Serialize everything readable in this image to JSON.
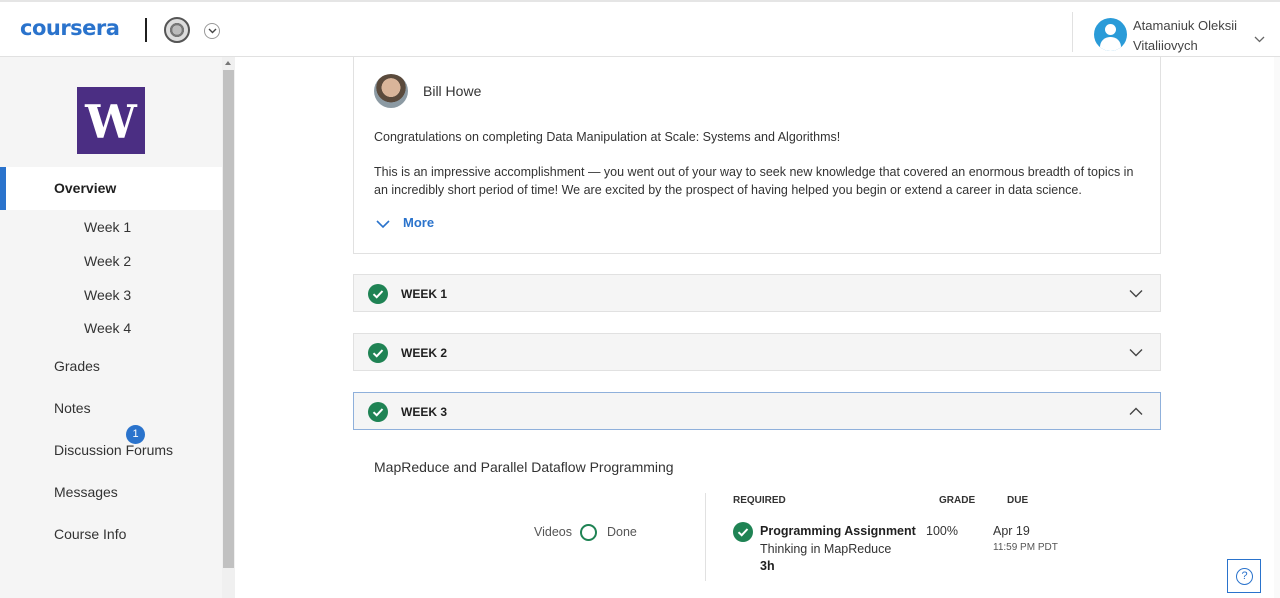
{
  "header": {
    "logo": "coursera",
    "user_name_line1": "Atamaniuk Oleksii",
    "user_name_line2": "Vitaliiovych"
  },
  "sidebar": {
    "logo_letter": "W",
    "active": "Overview",
    "weeks": [
      "Week 1",
      "Week 2",
      "Week 3",
      "Week 4"
    ],
    "items": [
      "Grades",
      "Notes",
      "Discussion Forums",
      "Messages",
      "Course Info"
    ],
    "messages_badge": "1"
  },
  "instructor": {
    "name": "Bill Howe",
    "message1": "Congratulations on completing Data Manipulation at Scale: Systems and Algorithms!",
    "message2": "This is an impressive accomplishment — you went out of your way to seek new knowledge that covered an enormous breadth of topics in an incredibly short period of time! We are excited by the prospect of having helped you begin or extend a career in data science.",
    "more_label": "More"
  },
  "weeks": [
    {
      "label": "WEEK 1",
      "expanded": false
    },
    {
      "label": "WEEK 2",
      "expanded": false
    },
    {
      "label": "WEEK 3",
      "expanded": true
    }
  ],
  "week3": {
    "module_title": "MapReduce and Parallel Dataflow Programming",
    "videos_label": "Videos",
    "videos_status": "Done",
    "headers": {
      "required": "REQUIRED",
      "grade": "GRADE",
      "due": "DUE"
    },
    "assignment": {
      "title": "Programming Assignment",
      "subtitle": "Thinking in MapReduce",
      "duration": "3h",
      "grade": "100%",
      "due_date": "Apr 19",
      "due_time": "11:59 PM PDT"
    }
  },
  "help_icon": "question-circle-icon",
  "colors": {
    "accent": "#2a73cc",
    "success": "#1f8354",
    "uw_purple": "#4b2e83"
  }
}
